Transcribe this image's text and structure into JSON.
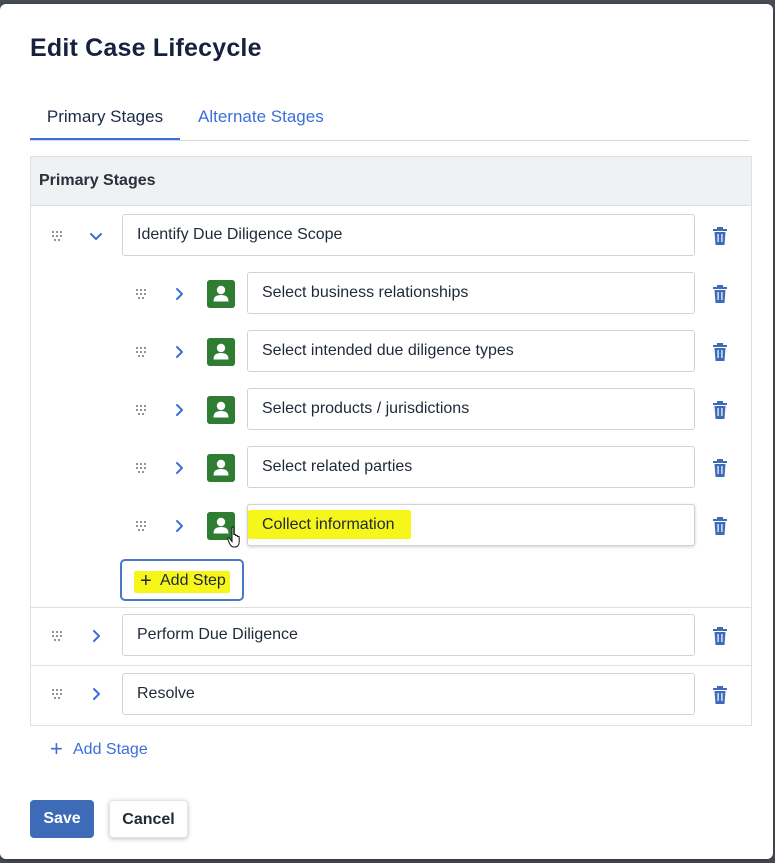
{
  "modal": {
    "title": "Edit Case Lifecycle"
  },
  "tabs": [
    {
      "label": "Primary Stages",
      "active": true
    },
    {
      "label": "Alternate Stages",
      "active": false
    }
  ],
  "table": {
    "header": "Primary Stages"
  },
  "stages": [
    {
      "name": "Identify Due Diligence Scope",
      "expanded": true,
      "steps": [
        {
          "name": "Select business relationships",
          "icon": "person-icon"
        },
        {
          "name": "Select intended due diligence types",
          "icon": "person-icon"
        },
        {
          "name": "Select products / jurisdictions",
          "icon": "person-icon"
        },
        {
          "name": "Select related parties",
          "icon": "person-icon"
        },
        {
          "name": "Collect information",
          "icon": "person-icon",
          "highlighted": true
        }
      ],
      "add_step_label": "Add Step"
    },
    {
      "name": "Perform Due Diligence",
      "expanded": false
    },
    {
      "name": "Resolve",
      "expanded": false
    }
  ],
  "add_stage_label": "Add Stage",
  "footer": {
    "save_label": "Save",
    "cancel_label": "Cancel"
  },
  "colors": {
    "accent": "#3b6fd8",
    "primary_button": "#3e6bb8",
    "step_icon": "#2e7d32",
    "highlight": "#f6f61a",
    "heading": "#16213e"
  }
}
